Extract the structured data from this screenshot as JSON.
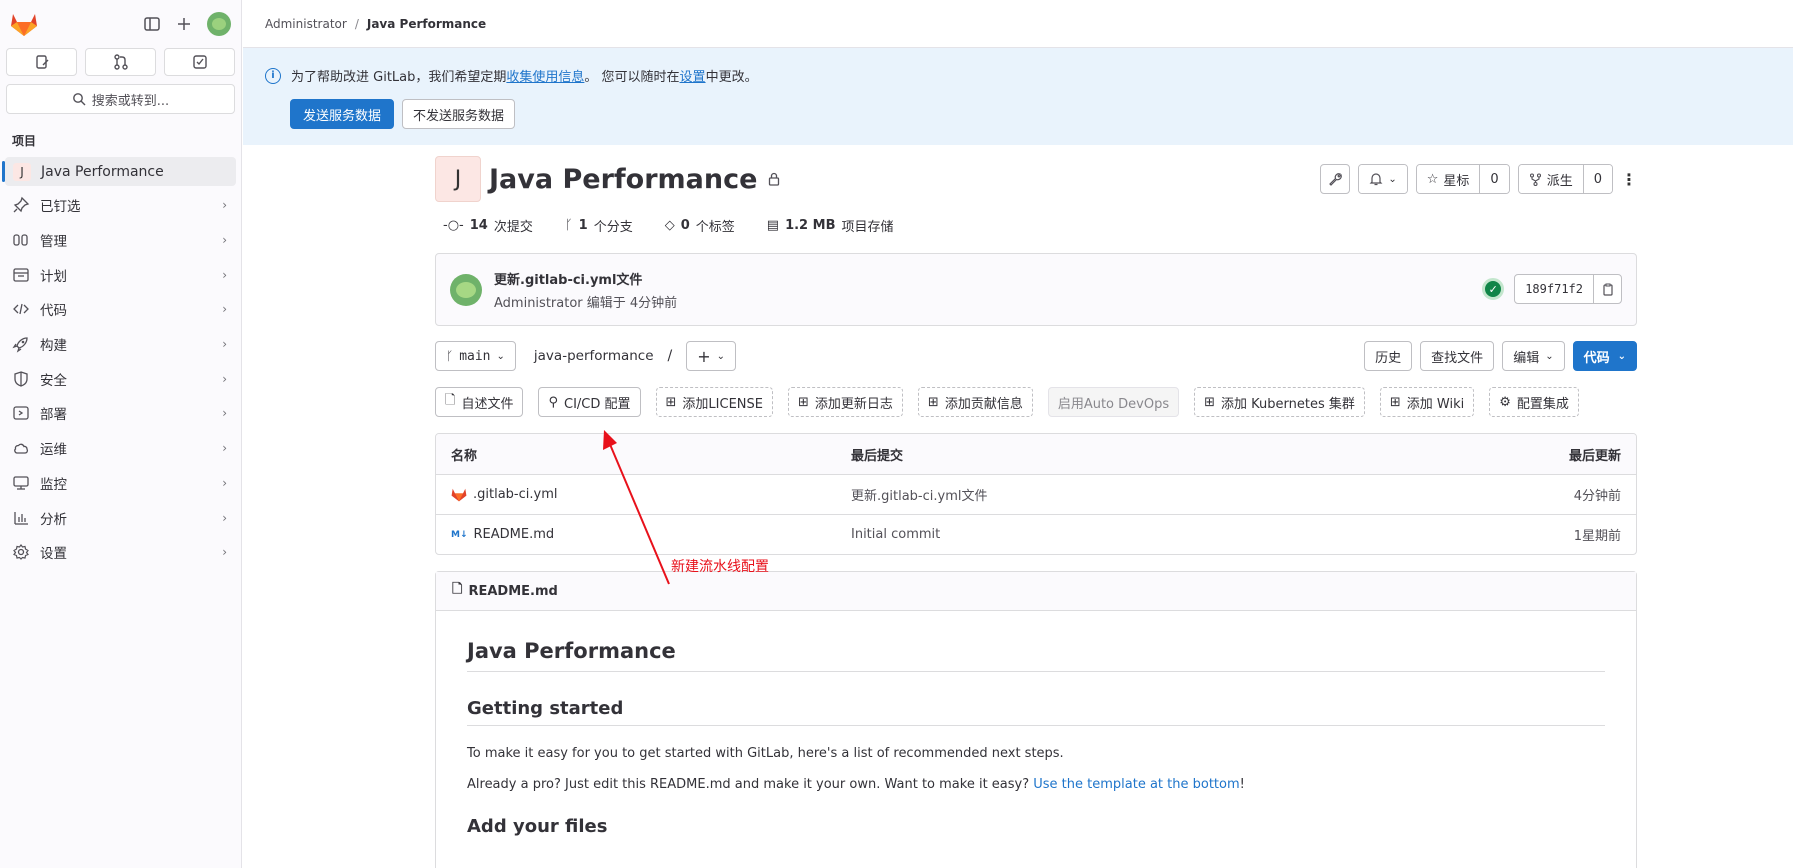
{
  "sidebar": {
    "section_title": "项目",
    "search_label": "搜索或转到...",
    "project": {
      "initial": "J",
      "name": "Java Performance"
    },
    "items": [
      {
        "label": "已钉选",
        "icon": "pin-icon"
      },
      {
        "label": "管理",
        "icon": "users-icon"
      },
      {
        "label": "计划",
        "icon": "calendar-icon"
      },
      {
        "label": "代码",
        "icon": "code-icon"
      },
      {
        "label": "构建",
        "icon": "rocket-icon"
      },
      {
        "label": "安全",
        "icon": "shield-icon"
      },
      {
        "label": "部署",
        "icon": "deploy-icon"
      },
      {
        "label": "运维",
        "icon": "cloud-icon"
      },
      {
        "label": "监控",
        "icon": "monitor-icon"
      },
      {
        "label": "分析",
        "icon": "chart-icon"
      },
      {
        "label": "设置",
        "icon": "gear-icon"
      }
    ]
  },
  "breadcrumb": {
    "parent": "Administrator",
    "sep": "/",
    "current": "Java Performance"
  },
  "banner": {
    "text_before": "为了帮助改进 GitLab，我们希望定期",
    "link1": "收集使用信息",
    "text_middle": "。 您可以随时在",
    "link2": "设置",
    "text_after": "中更改。",
    "send_button": "发送服务数据",
    "dont_send_button": "不发送服务数据"
  },
  "project": {
    "initial": "J",
    "title": "Java Performance",
    "star_label": "星标",
    "star_count": "0",
    "fork_label": "派生",
    "fork_count": "0"
  },
  "stats": {
    "commits_count": "14",
    "commits_label": "次提交",
    "branches_count": "1",
    "branches_label": "个分支",
    "tags_count": "0",
    "tags_label": "个标签",
    "storage_size": "1.2 MB",
    "storage_label": "项目存储"
  },
  "last_commit": {
    "title": "更新.gitlab-ci.yml文件",
    "author": "Administrator",
    "meta": "编辑于 4分钟前",
    "sha": "189f71f2"
  },
  "repo_nav": {
    "branch": "main",
    "path": "java-performance",
    "path_sep": "/",
    "history": "历史",
    "find_file": "查找文件",
    "edit": "编辑",
    "code": "代码"
  },
  "shortcuts": {
    "readme": "自述文件",
    "cicd": "CI/CD 配置",
    "license": "添加LICENSE",
    "changelog": "添加更新日志",
    "contributing": "添加贡献信息",
    "autodevops": "启用Auto DevOps",
    "kubernetes": "添加 Kubernetes 集群",
    "wiki": "添加 Wiki",
    "integrations": "配置集成"
  },
  "files": {
    "headers": {
      "name": "名称",
      "last_commit": "最后提交",
      "last_update": "最后更新"
    },
    "rows": [
      {
        "name": ".gitlab-ci.yml",
        "commit": "更新.gitlab-ci.yml文件",
        "updated": "4分钟前"
      },
      {
        "name": "README.md",
        "commit": "Initial commit",
        "updated": "1星期前"
      }
    ]
  },
  "readme": {
    "filename": "README.md",
    "h1": "Java Performance",
    "h2": "Getting started",
    "p1": "To make it easy for you to get started with GitLab, here's a list of recommended next steps.",
    "p2_before": "Already a pro? Just edit this README.md and make it your own. Want to make it easy? ",
    "p2_link": "Use the template at the bottom",
    "p2_after": "!",
    "h2b": "Add your files"
  },
  "annotation": {
    "text": "新建流水线配置",
    "color": "#e8111b"
  },
  "colors": {
    "accent": "#1f75cb",
    "success": "#108548",
    "banner_bg": "#e9f3fc",
    "gitlab_orange": "#fc6d26"
  }
}
